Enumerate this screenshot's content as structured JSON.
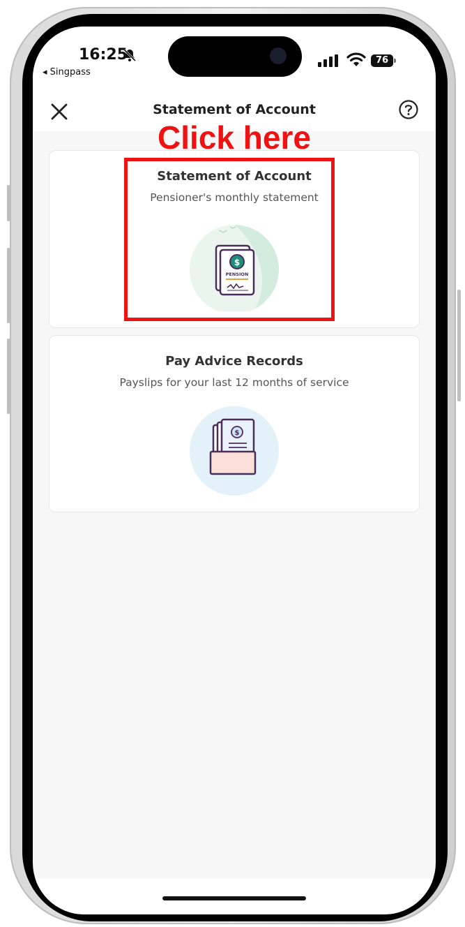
{
  "status_bar": {
    "time": "16:25",
    "back_app": "◂ Singpass",
    "battery": "76"
  },
  "nav": {
    "title": "Statement of Account"
  },
  "annotation": {
    "text": "Click here",
    "color": "#ee1212"
  },
  "cards": [
    {
      "title": "Statement of Account",
      "subtitle": "Pensioner's monthly statement",
      "icon": "pension-statement-icon",
      "icon_text": "PENSION"
    },
    {
      "title": "Pay Advice Records",
      "subtitle": "Payslips for your last 12 months of service",
      "icon": "payslip-records-icon"
    }
  ]
}
